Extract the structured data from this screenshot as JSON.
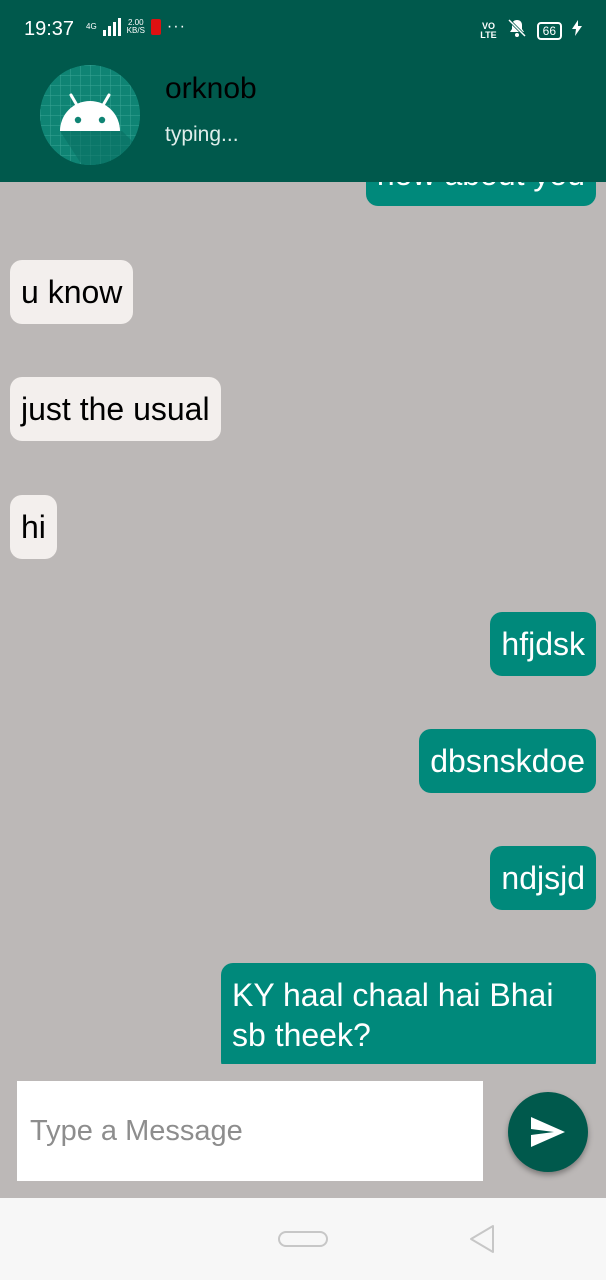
{
  "status_bar": {
    "time": "19:37",
    "network": "4G",
    "speed_value": "2.00",
    "speed_unit": "KB/S",
    "more": "···",
    "volte_top": "VO",
    "volte_bottom": "LTE",
    "battery": "66",
    "icons": [
      "signal-icon",
      "record-icon",
      "more-dots-icon",
      "volte-icon",
      "mute-icon",
      "battery-icon",
      "charging-icon"
    ]
  },
  "header": {
    "contact_name": "orknob",
    "status": "typing...",
    "avatar_icon": "android-icon"
  },
  "messages": [
    {
      "direction": "out",
      "text": "how about you"
    },
    {
      "direction": "in",
      "text": "u know"
    },
    {
      "direction": "in",
      "text": "just the usual"
    },
    {
      "direction": "in",
      "text": "hi"
    },
    {
      "direction": "out",
      "text": "hfjdsk"
    },
    {
      "direction": "out",
      "text": "dbsnskdoe"
    },
    {
      "direction": "out",
      "text": "ndjsjd"
    },
    {
      "direction": "out",
      "text": "KY haal chaal hai Bhai sb theek?"
    }
  ],
  "composer": {
    "placeholder": "Type a Message",
    "value": "",
    "send_icon": "send-icon"
  },
  "nav": {
    "icons": [
      "home-icon",
      "back-icon"
    ]
  },
  "colors": {
    "primary_dark": "#00594c",
    "outgoing_bubble": "#00897b",
    "incoming_bubble": "#f3efed",
    "chat_background": "#bcb8b7"
  }
}
